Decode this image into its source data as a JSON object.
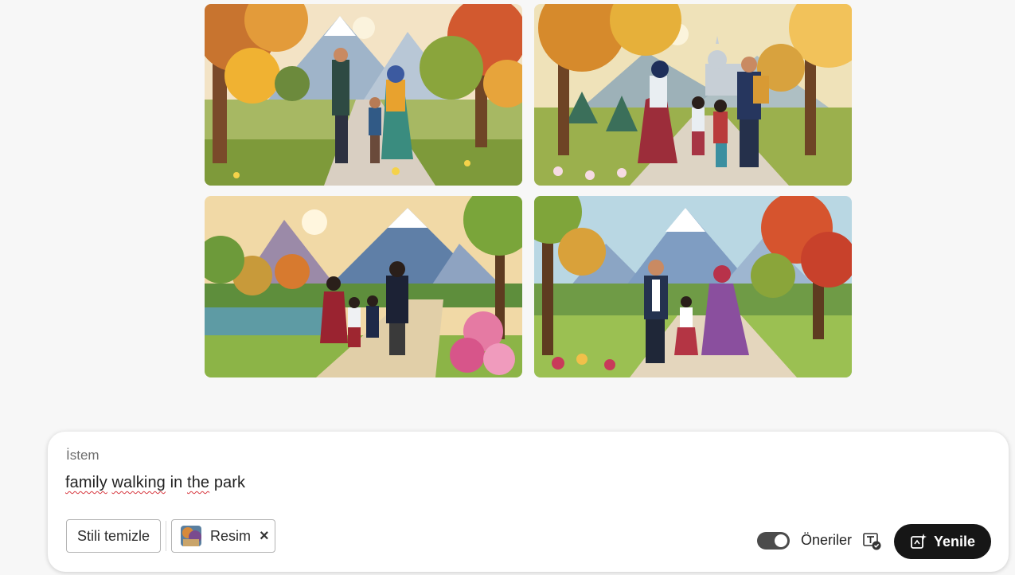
{
  "gallery": {
    "images": [
      {
        "name": "generated-image-1",
        "alt": ""
      },
      {
        "name": "generated-image-2",
        "alt": ""
      },
      {
        "name": "generated-image-3",
        "alt": ""
      },
      {
        "name": "generated-image-4",
        "alt": ""
      }
    ]
  },
  "prompt": {
    "label": "İstem",
    "text_words": [
      "family",
      "walking",
      "in",
      "the",
      "park"
    ],
    "misspelled_flags": [
      true,
      true,
      false,
      true,
      false
    ]
  },
  "chips": {
    "clear_style_label": "Stili temizle",
    "image_label": "Resim",
    "remove_symbol": "×"
  },
  "controls": {
    "suggestions_label": "Öneriler",
    "suggestions_enabled": true,
    "regenerate_label": "Yenile"
  },
  "icons": {
    "text_check": "text-check-icon",
    "regenerate": "regenerate-sparkle-icon",
    "close": "close-icon"
  },
  "colors": {
    "background": "#f7f7f7",
    "button_dark": "#161616",
    "toggle_on": "#4b4b4b",
    "spellcheck_underline": "#d7373f"
  }
}
